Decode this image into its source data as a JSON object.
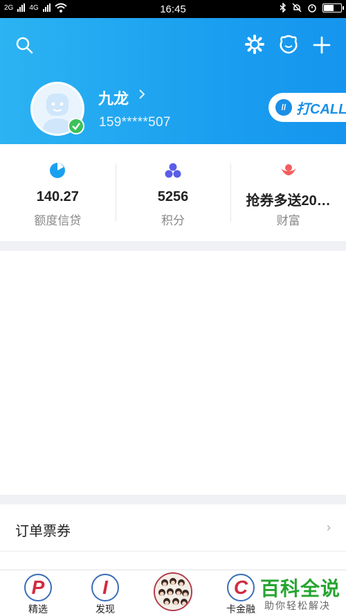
{
  "status_bar": {
    "network_left": "2G",
    "network_right": "4G",
    "time": "16:45",
    "battery_level": 0.6
  },
  "header": {
    "username": "九龙",
    "phone": "159*****507",
    "call_button": "打CALL",
    "call_icon_text": "//"
  },
  "stats": [
    {
      "value": "140.27",
      "label": "额度信贷",
      "icon": "pie-chart-icon",
      "color": "#1aa0f0"
    },
    {
      "value": "5256",
      "label": "积分",
      "icon": "three-dots-icon",
      "color": "#5a5ee8"
    },
    {
      "value": "抢券多送20…",
      "label": "财富",
      "icon": "ingot-icon",
      "color": "#f45d5d"
    }
  ],
  "menu": {
    "orders_label": "订单票券",
    "chevron": "›"
  },
  "tabbar": {
    "tabs": [
      {
        "label": "精选",
        "letter": "P"
      },
      {
        "label": "发现",
        "letter": "I"
      },
      {
        "label": "卡金融",
        "letter": "C"
      }
    ]
  },
  "watermark": {
    "title": "百科全说",
    "subtitle": "助你轻松解决"
  },
  "colors": {
    "header_gradient_start": "#2cb3f2",
    "header_gradient_end": "#1595ee",
    "verified_green": "#3cc15a",
    "tab_letter_red": "#d22a3f",
    "tab_ring_blue": "#3a6db8"
  }
}
